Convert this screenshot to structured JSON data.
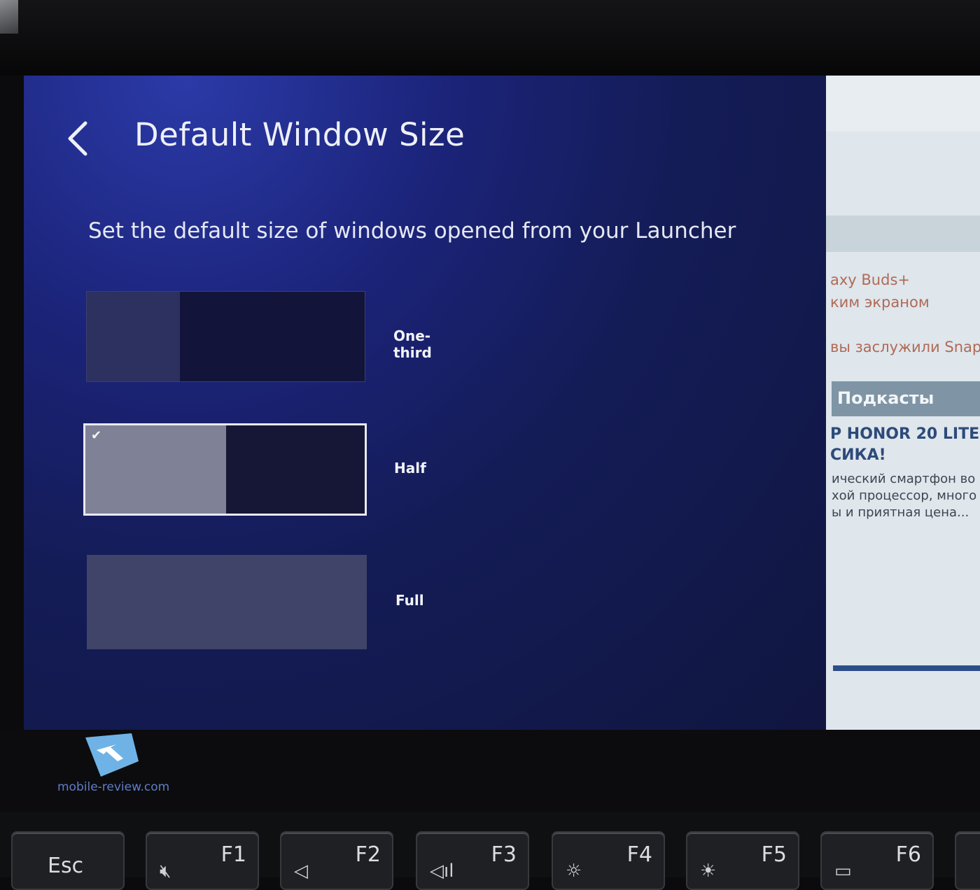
{
  "settings": {
    "title": "Default Window Size",
    "subtitle": "Set the default size of windows opened from your Launcher",
    "options": [
      {
        "label": "One-third",
        "fill": 0.333,
        "selected": false
      },
      {
        "label": "Half",
        "fill": 0.5,
        "selected": true
      },
      {
        "label": "Full",
        "fill": 1.0,
        "selected": false
      }
    ]
  },
  "background_page": {
    "line1": "axy Buds+",
    "line2": "ким экраном",
    "line3": "вы заслужили Snapdra",
    "section": "Подкасты",
    "headline1": "Р HONOR 20 LITE",
    "headline2": "СИКА!",
    "desc1": "ический смартфон во",
    "desc2": "хой процессор, много",
    "desc3": "ы и приятная цена..."
  },
  "watermark": "mobile-review.com",
  "keyboard": {
    "keys": [
      {
        "label": "Esc",
        "icon": ""
      },
      {
        "label": "F1",
        "icon": "mute-icon"
      },
      {
        "label": "F2",
        "icon": "volume-down-icon"
      },
      {
        "label": "F3",
        "icon": "volume-up-icon"
      },
      {
        "label": "F4",
        "icon": "brightness-down-icon"
      },
      {
        "label": "F5",
        "icon": "brightness-up-icon"
      },
      {
        "label": "F6",
        "icon": "window-icon"
      }
    ]
  },
  "colors": {
    "panel_bg": "#141c57",
    "selected_border": "#e9eaf2"
  }
}
